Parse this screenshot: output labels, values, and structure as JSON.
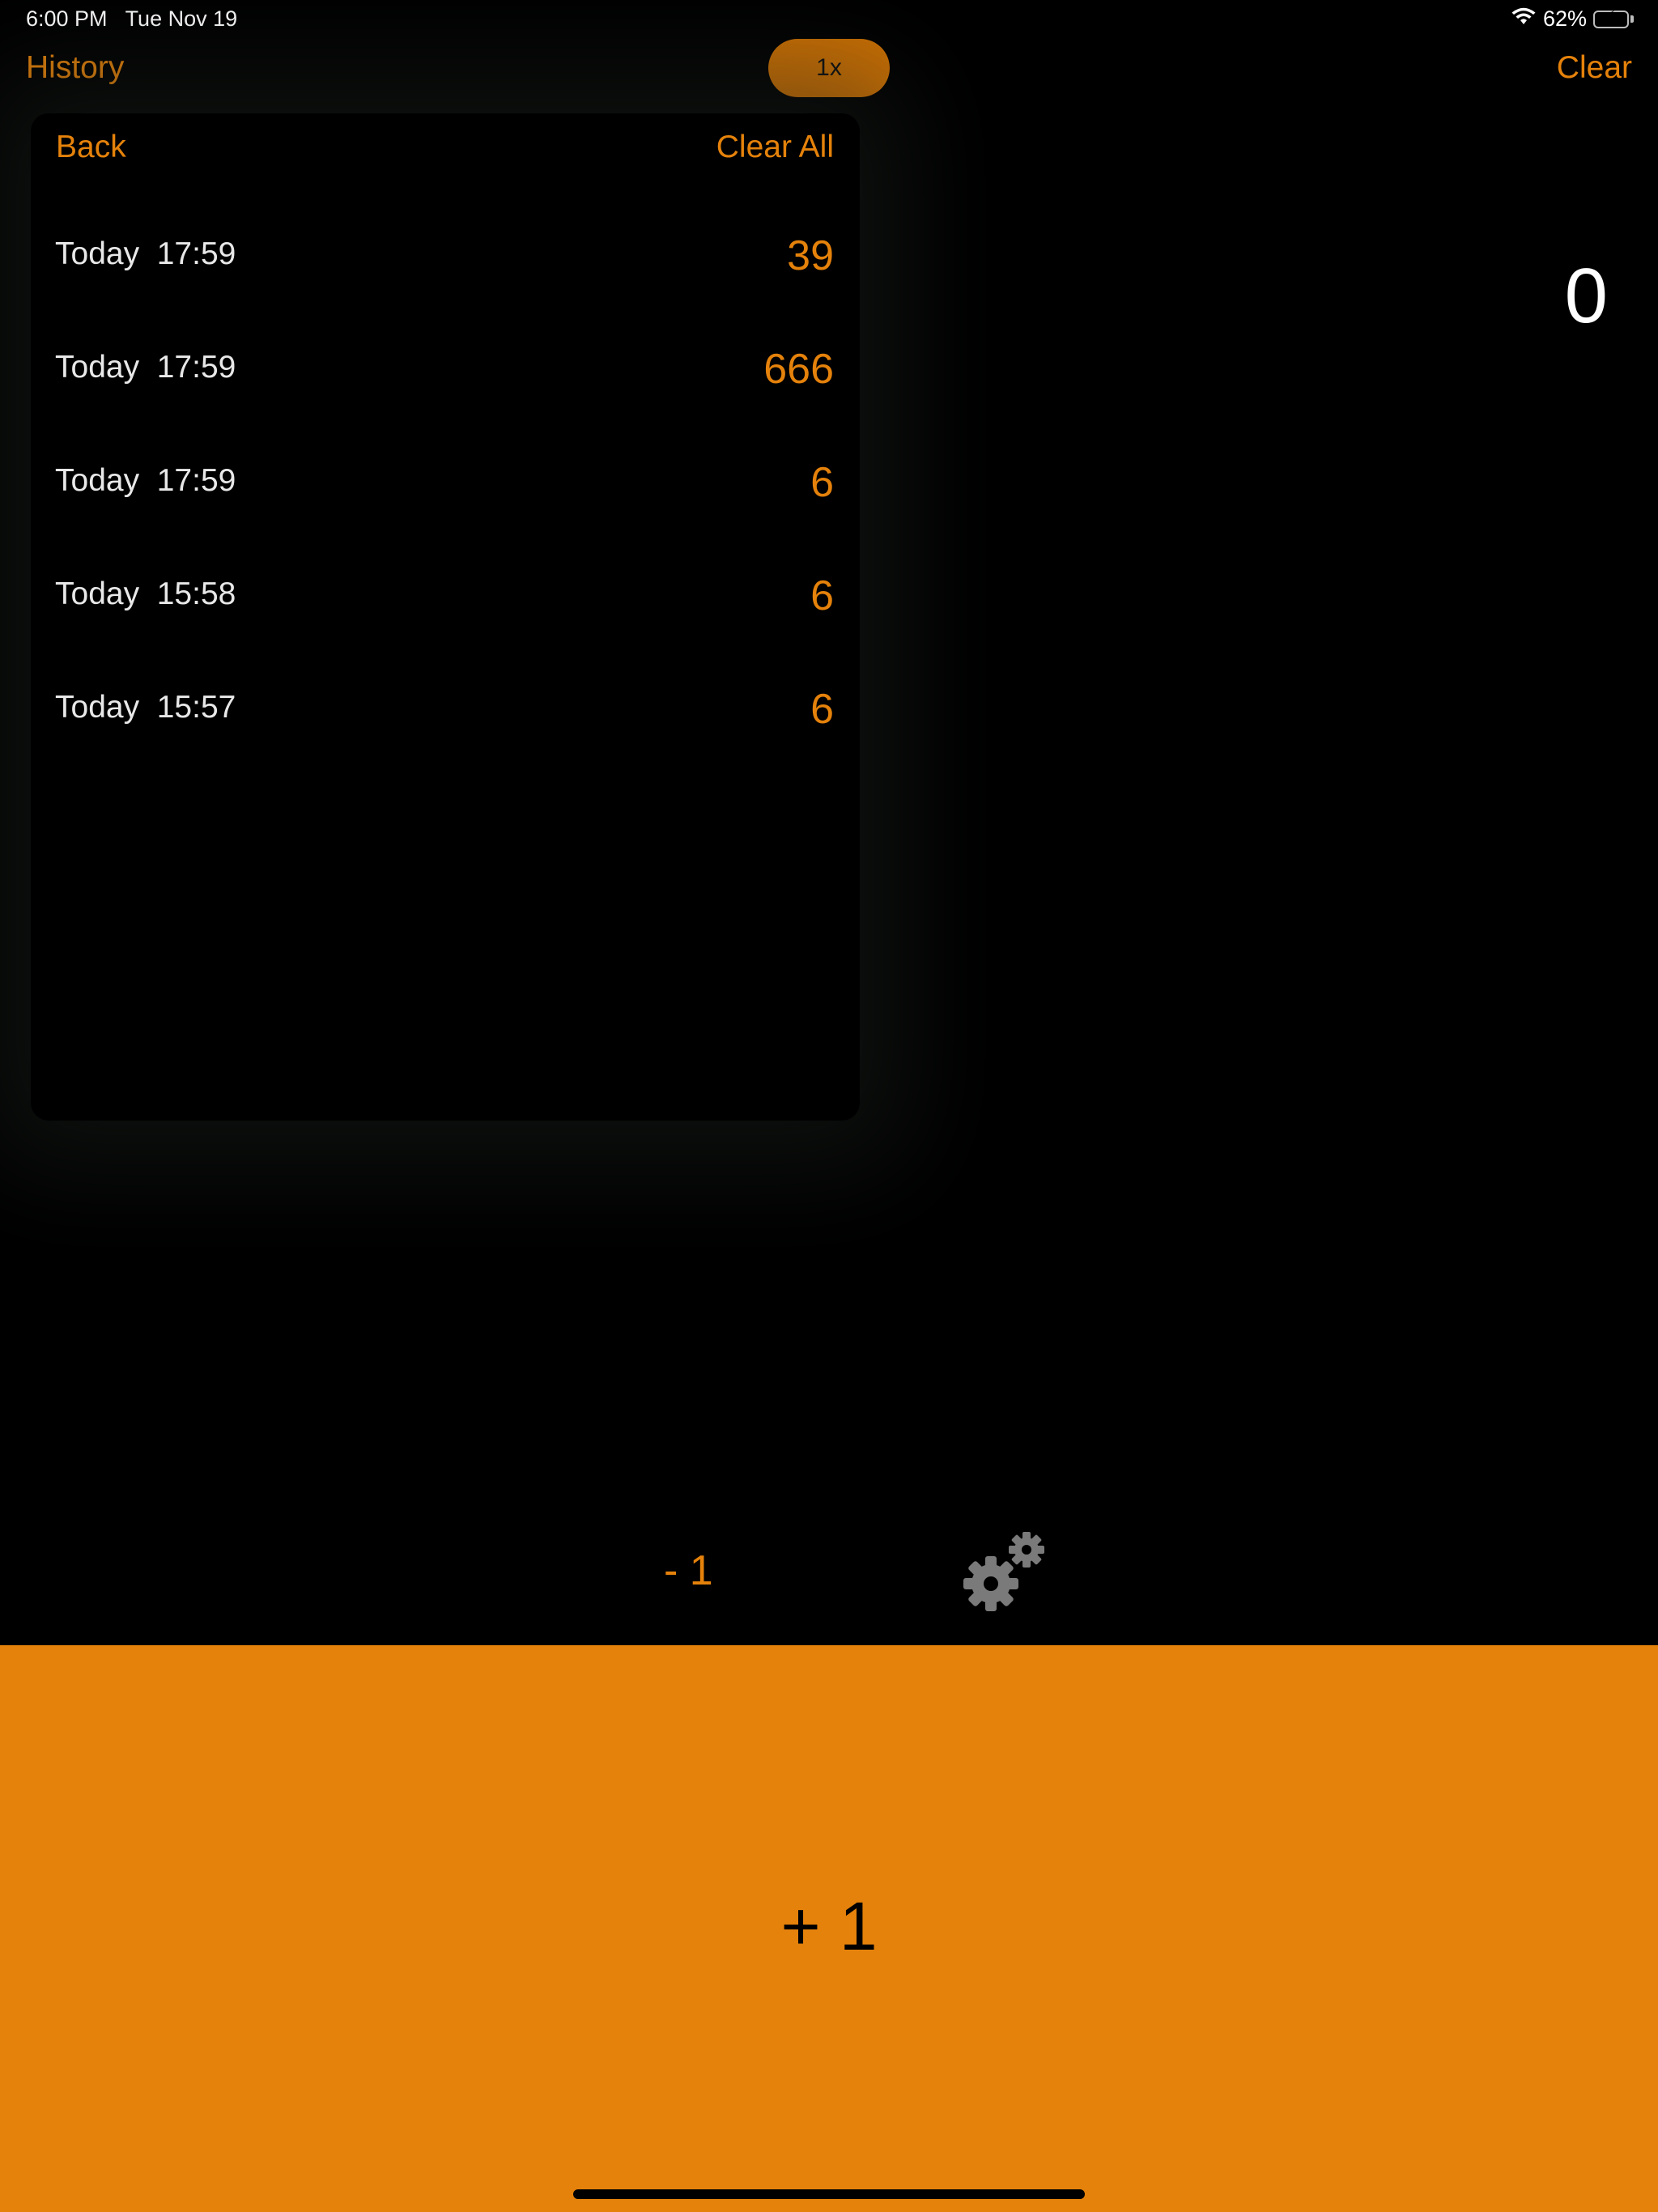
{
  "status_bar": {
    "time": "6:00 PM",
    "date": "Tue Nov 19",
    "battery_percent": "62%",
    "battery_level": 0.62,
    "icons": [
      "wifi-icon",
      "battery-charging-icon"
    ]
  },
  "nav": {
    "history_label": "History",
    "speed_label": "1x",
    "clear_label": "Clear"
  },
  "counter": {
    "value": "0"
  },
  "history_panel": {
    "back_label": "Back",
    "clear_all_label": "Clear All",
    "entries": [
      {
        "time": "Today  17:59",
        "value": "39"
      },
      {
        "time": "Today  17:59",
        "value": "666"
      },
      {
        "time": "Today  17:59",
        "value": "6"
      },
      {
        "time": "Today  15:58",
        "value": "6"
      },
      {
        "time": "Today  15:57",
        "value": "6"
      }
    ]
  },
  "controls": {
    "minus_label": "- 1",
    "plus_label": "+ 1",
    "settings_icon": "gears-icon"
  },
  "colors": {
    "accent": "#e5820b",
    "pill": "#cc7003",
    "background": "#000000",
    "text": "#ffffff",
    "gear": "#7a7a7a"
  }
}
